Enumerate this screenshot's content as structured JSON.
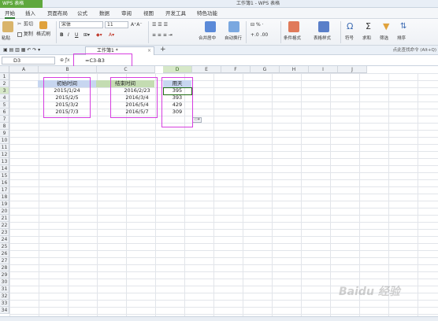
{
  "titlebar": {
    "app_menu": "WPS 表格",
    "window_title": "工作簿1 - WPS 表格"
  },
  "menubar": {
    "tabs": [
      "开始",
      "插入",
      "页面布局",
      "公式",
      "数据",
      "审阅",
      "视图",
      "开发工具",
      "特色功能"
    ]
  },
  "ribbon": {
    "paste": "粘贴",
    "cut": "剪切",
    "copy": "复制",
    "format_painter": "格式刷",
    "font_name": "宋体",
    "font_size": "11",
    "merge_center": "合并居中",
    "wrap": "自动换行",
    "conditional_format": "条件格式",
    "table_style": "表格样式",
    "symbol": "符号",
    "sum": "求和",
    "filter": "筛选",
    "sort": "排序",
    "percent": "%"
  },
  "docbar": {
    "doc_tab": "工作簿1 *",
    "new_tab": "+",
    "hint": "点此查找命令 (Alt+Q)"
  },
  "formulabar": {
    "namebox": "D3",
    "formula": "=C3-B3"
  },
  "grid": {
    "columns": [
      "A",
      "B",
      "C",
      "D",
      "E",
      "F",
      "G",
      "H",
      "I",
      "J"
    ],
    "rows": [
      "1",
      "2",
      "3",
      "4",
      "5",
      "6",
      "7",
      "8",
      "9",
      "10",
      "11",
      "12",
      "13",
      "14",
      "15",
      "16",
      "17",
      "18",
      "19",
      "20",
      "21",
      "22",
      "23",
      "24",
      "25",
      "26",
      "27",
      "28",
      "29",
      "30",
      "31",
      "32",
      "33",
      "34"
    ],
    "headers": {
      "b": "初始时间",
      "c": "结束时间",
      "d": "用天"
    },
    "start_dates": [
      "2015/1/24",
      "2015/2/5",
      "2015/3/2",
      "2015/7/3"
    ],
    "end_dates": [
      "2016/2/23",
      "2016/3/4",
      "2016/5/4",
      "2016/5/7"
    ],
    "days": [
      "395",
      "393",
      "429",
      "309"
    ]
  },
  "watermark": "Baidu 经验",
  "colors": {
    "highlight": "#d63ee0",
    "header_fill_b": "#c7d6f0",
    "header_fill_c": "#c4dcb2",
    "header_fill_d": "#c7d6f0"
  }
}
